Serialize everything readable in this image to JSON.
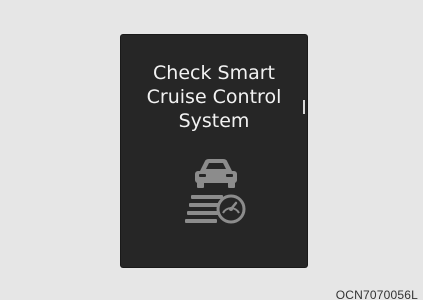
{
  "display": {
    "message_lines": [
      "Check Smart",
      "Cruise Control",
      "System"
    ],
    "icon": "smart-cruise-control-warning-icon"
  },
  "photo_code": "OCN7070056L",
  "colors": {
    "background": "#e6e6e6",
    "screen": "#262626",
    "text": "#f2f2f2",
    "icon": "#8c8c8c"
  }
}
